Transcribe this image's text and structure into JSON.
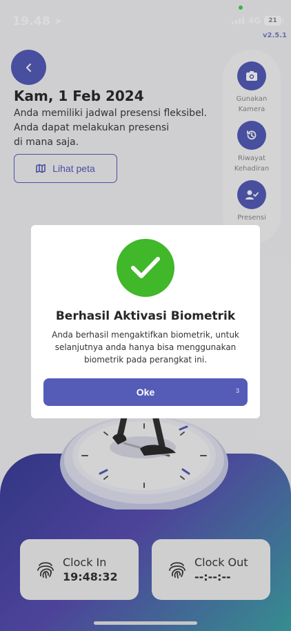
{
  "status_bar": {
    "time": "19.48",
    "network": "4G",
    "battery": "21"
  },
  "app": {
    "version": "v2.5.1"
  },
  "header": {
    "date": "Kam, 1 Feb 2024",
    "schedule_lines": [
      "Anda memiliki jadwal presensi fleksibel.",
      "Anda dapat melakukan presensi",
      "di mana saja."
    ],
    "map_button_label": "Lihat peta"
  },
  "side_menu": {
    "items": [
      {
        "label_line1": "Gunakan",
        "label_line2": "Kamera",
        "icon": "camera-icon"
      },
      {
        "label_line1": "Riwayat",
        "label_line2": "Kehadiran",
        "icon": "history-icon"
      },
      {
        "label_line1": "Presensi",
        "label_line2": "",
        "icon": "user-check-icon"
      }
    ]
  },
  "modal": {
    "title": "Berhasil Aktivasi Biometrik",
    "message": "Anda berhasil mengaktifkan biometrik, untuk selanjutnya anda hanya bisa menggunakan biometrik pada perangkat ini.",
    "button_label": "Oke",
    "countdown": "3"
  },
  "clock": {
    "in_label": "Clock In",
    "in_time": "19:48:32",
    "out_label": "Clock Out",
    "out_time": "--:--:--"
  },
  "colors": {
    "accent": "#545cb8",
    "success": "#41b72a"
  }
}
